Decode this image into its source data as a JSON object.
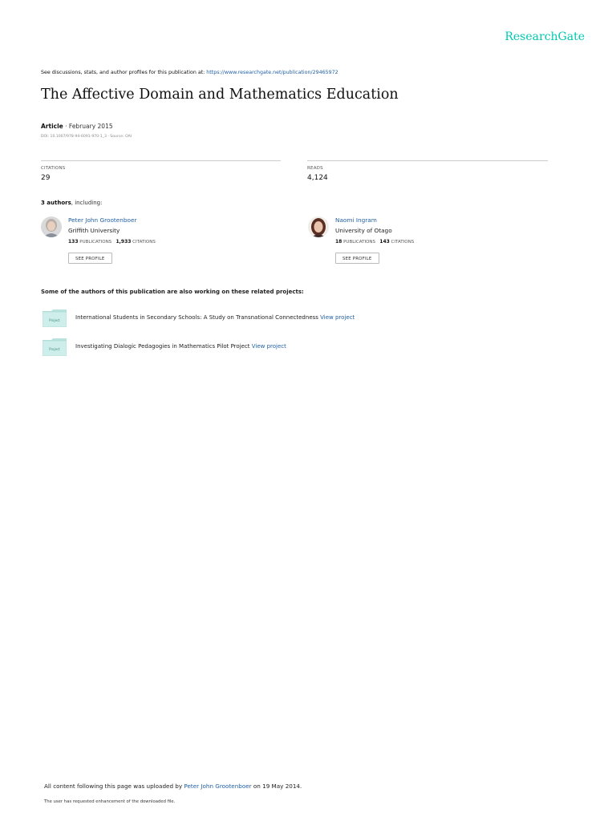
{
  "header": {
    "logo": "ResearchGate"
  },
  "top_line": {
    "prefix": "See discussions, stats, and author profiles for this publication at: ",
    "url": "https://www.researchgate.net/publication/29465972"
  },
  "publication": {
    "title": "The Affective Domain and Mathematics Education",
    "type": "Article",
    "date": " · February 2015",
    "doi": "DOI: 10.1007/978-94-6091-970-1_3 · Source: OAI"
  },
  "stats": {
    "citations_label": "CITATIONS",
    "citations_value": "29",
    "reads_label": "READS",
    "reads_value": "4,124"
  },
  "authors_heading": {
    "count": "3 authors",
    "suffix": ", including:"
  },
  "authors": [
    {
      "name": "Peter John Grootenboer",
      "institution": "Griffith University",
      "publications": "133",
      "publications_label": " PUBLICATIONS",
      "citations": "1,933",
      "citations_label": " CITATIONS",
      "button": "SEE PROFILE"
    },
    {
      "name": "Naomi Ingram",
      "institution": "University of Otago",
      "publications": "18",
      "publications_label": " PUBLICATIONS",
      "citations": "143",
      "citations_label": " CITATIONS",
      "button": "SEE PROFILE"
    }
  ],
  "related": {
    "heading": "Some of the authors of this publication are also working on these related projects:",
    "projects": [
      {
        "icon_label": "Project",
        "title": "International Students in Secondary Schools: A Study on Transnational Connectedness ",
        "link": "View project"
      },
      {
        "icon_label": "Project",
        "title": "Investigating Dialogic Pedagogies in Mathematics Pilot Project ",
        "link": "View project"
      }
    ]
  },
  "footer": {
    "prefix": "All content following this page was uploaded by ",
    "uploader": "Peter John Grootenboer",
    "suffix": " on 19 May 2014.",
    "note": "The user has requested enhancement of the downloaded file."
  },
  "colors": {
    "brand": "#00c8b0",
    "link": "#1f5fa8"
  }
}
